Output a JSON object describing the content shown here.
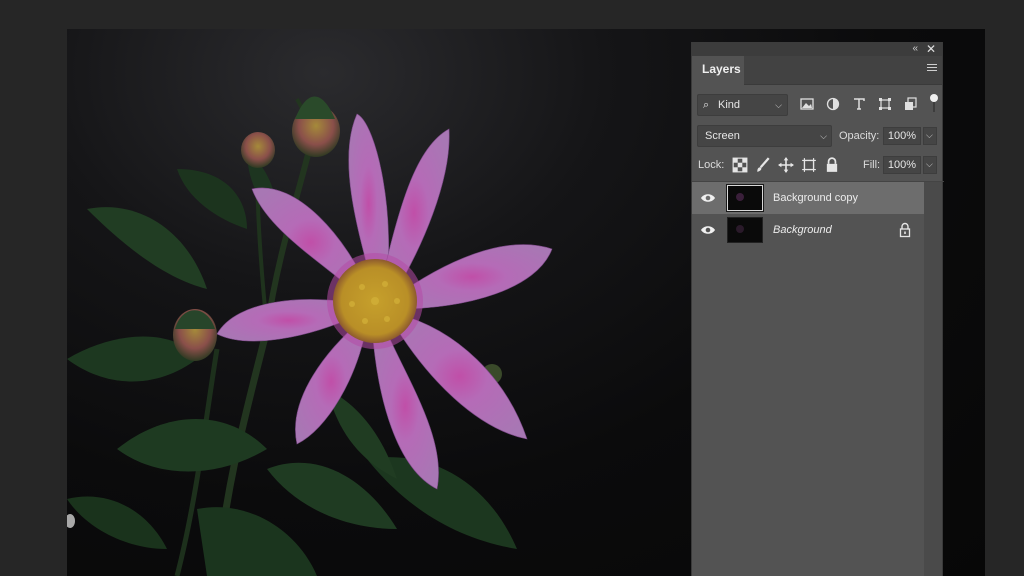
{
  "window": {
    "collapse_glyph": "«",
    "close_glyph": "✕"
  },
  "panel": {
    "tab_label": "Layers",
    "menu_icon": "hamburger-menu-icon"
  },
  "filter": {
    "kind_label": "Kind",
    "icons": [
      "image-filter-icon",
      "adjustment-filter-icon",
      "type-filter-icon",
      "shape-filter-icon",
      "smart-object-filter-icon"
    ],
    "toggle_icon": "filter-toggle-icon"
  },
  "blend": {
    "mode": "Screen",
    "opacity_label": "Opacity:",
    "opacity_value": "100%"
  },
  "lock": {
    "label": "Lock:",
    "icons": [
      "lock-transparent-pixels-icon",
      "lock-image-pixels-icon",
      "lock-position-icon",
      "lock-artboard-icon",
      "lock-all-icon"
    ],
    "fill_label": "Fill:",
    "fill_value": "100%"
  },
  "layers": [
    {
      "name": "Background copy",
      "visible": true,
      "selected": true,
      "locked": false,
      "italic": false
    },
    {
      "name": "Background",
      "visible": true,
      "selected": false,
      "locked": true,
      "italic": true
    }
  ],
  "colors": {
    "panel_bg": "#535353",
    "selected_layer": "#6d6d6d",
    "app_bg": "#282828",
    "petal": "#b56bb7",
    "center": "#c9a22a",
    "leaf": "#1f3a22"
  }
}
